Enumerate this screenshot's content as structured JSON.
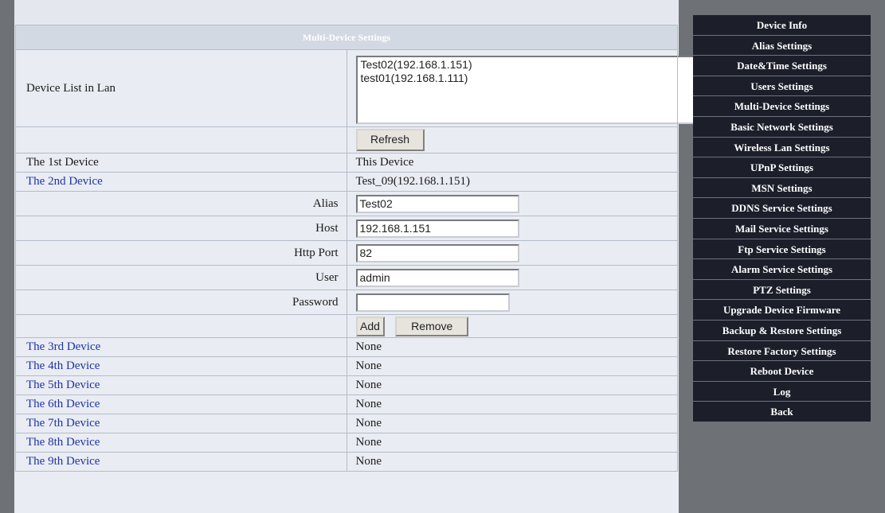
{
  "header": {
    "title": "Multi-Device Settings"
  },
  "lan": {
    "label": "Device List in Lan",
    "devices": [
      "Test02(192.168.1.151)",
      "test01(192.168.1.111)"
    ],
    "refresh_label": "Refresh"
  },
  "first_device": {
    "label": "The 1st Device",
    "value": "This Device"
  },
  "second_device": {
    "label": "The 2nd Device",
    "value": "Test_09(192.168.1.151)",
    "fields": {
      "alias": {
        "label": "Alias",
        "value": "Test02"
      },
      "host": {
        "label": "Host",
        "value": "192.168.1.151"
      },
      "http_port": {
        "label": "Http Port",
        "value": "82"
      },
      "user": {
        "label": "User",
        "value": "admin"
      },
      "password": {
        "label": "Password",
        "value": ""
      }
    },
    "add_label": "Add",
    "remove_label": "Remove"
  },
  "other_devices": [
    {
      "label": "The 3rd Device",
      "value": "None"
    },
    {
      "label": "The 4th Device",
      "value": "None"
    },
    {
      "label": "The 5th Device",
      "value": "None"
    },
    {
      "label": "The 6th Device",
      "value": "None"
    },
    {
      "label": "The 7th Device",
      "value": "None"
    },
    {
      "label": "The 8th Device",
      "value": "None"
    },
    {
      "label": "The 9th Device",
      "value": "None"
    }
  ],
  "menu": {
    "items": [
      "Device Info",
      "Alias Settings",
      "Date&Time Settings",
      "Users Settings",
      "Multi-Device Settings",
      "Basic Network Settings",
      "Wireless Lan Settings",
      "UPnP Settings",
      "MSN Settings",
      "DDNS Service Settings",
      "Mail Service Settings",
      "Ftp Service Settings",
      "Alarm Service Settings",
      "PTZ Settings",
      "Upgrade Device Firmware",
      "Backup & Restore Settings",
      "Restore Factory Settings",
      "Reboot Device",
      "Log",
      "Back"
    ]
  }
}
